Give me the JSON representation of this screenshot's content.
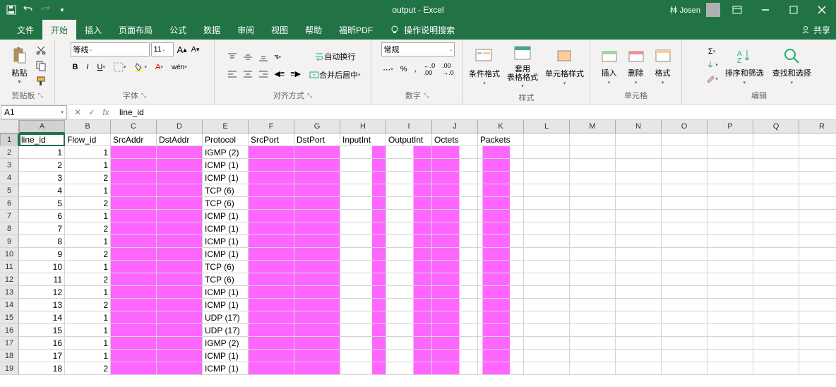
{
  "titlebar": {
    "title": "output  -  Excel",
    "user": "林 Josen"
  },
  "menu": {
    "file": "文件",
    "home": "开始",
    "insert": "插入",
    "layout": "页面布局",
    "formulas": "公式",
    "data": "数据",
    "review": "审阅",
    "view": "视图",
    "help": "帮助",
    "pdf": "福昕PDF",
    "tellme": "操作说明搜索",
    "share": "共享"
  },
  "ribbon": {
    "clipboard": {
      "paste": "粘贴",
      "label": "剪贴板"
    },
    "font": {
      "name": "等线",
      "size": "11",
      "label": "字体"
    },
    "align": {
      "wrap": "自动换行",
      "merge": "合并后居中",
      "label": "对齐方式"
    },
    "number": {
      "fmt": "常规",
      "label": "数字"
    },
    "styles": {
      "cond": "条件格式",
      "table": "套用\n表格格式",
      "cell": "单元格样式",
      "label": "样式"
    },
    "cells": {
      "insert": "插入",
      "delete": "删除",
      "format": "格式",
      "label": "单元格"
    },
    "edit": {
      "sort": "排序和筛选",
      "find": "查找和选择",
      "label": "编辑"
    }
  },
  "formulabar": {
    "cell": "A1",
    "value": "line_id"
  },
  "cols": [
    "A",
    "B",
    "C",
    "D",
    "E",
    "F",
    "G",
    "H",
    "I",
    "J",
    "K",
    "L",
    "M",
    "N",
    "O",
    "P",
    "Q",
    "R"
  ],
  "headers": [
    "line_id",
    "Flow_id",
    "SrcAddr",
    "DstAddr",
    "Protocol",
    "SrcPort",
    "DstPort",
    "InputInt",
    "OutputInt",
    "Octets",
    "Packets"
  ],
  "rows": [
    {
      "line": 1,
      "flow": 1,
      "proto": "IGMP (2)"
    },
    {
      "line": 2,
      "flow": 1,
      "proto": "ICMP (1)"
    },
    {
      "line": 3,
      "flow": 2,
      "proto": "ICMP (1)"
    },
    {
      "line": 4,
      "flow": 1,
      "proto": "TCP (6)"
    },
    {
      "line": 5,
      "flow": 2,
      "proto": "TCP (6)"
    },
    {
      "line": 6,
      "flow": 1,
      "proto": "ICMP (1)"
    },
    {
      "line": 7,
      "flow": 2,
      "proto": "ICMP (1)"
    },
    {
      "line": 8,
      "flow": 1,
      "proto": "ICMP (1)"
    },
    {
      "line": 9,
      "flow": 2,
      "proto": "ICMP (1)"
    },
    {
      "line": 10,
      "flow": 1,
      "proto": "TCP (6)"
    },
    {
      "line": 11,
      "flow": 2,
      "proto": "TCP (6)"
    },
    {
      "line": 12,
      "flow": 1,
      "proto": "ICMP (1)"
    },
    {
      "line": 13,
      "flow": 2,
      "proto": "ICMP (1)"
    },
    {
      "line": 14,
      "flow": 1,
      "proto": "UDP (17)"
    },
    {
      "line": 15,
      "flow": 1,
      "proto": "UDP (17)"
    },
    {
      "line": 16,
      "flow": 1,
      "proto": "IGMP (2)"
    },
    {
      "line": 17,
      "flow": 1,
      "proto": "ICMP (1)"
    },
    {
      "line": 18,
      "flow": 2,
      "proto": "ICMP (1)"
    }
  ]
}
